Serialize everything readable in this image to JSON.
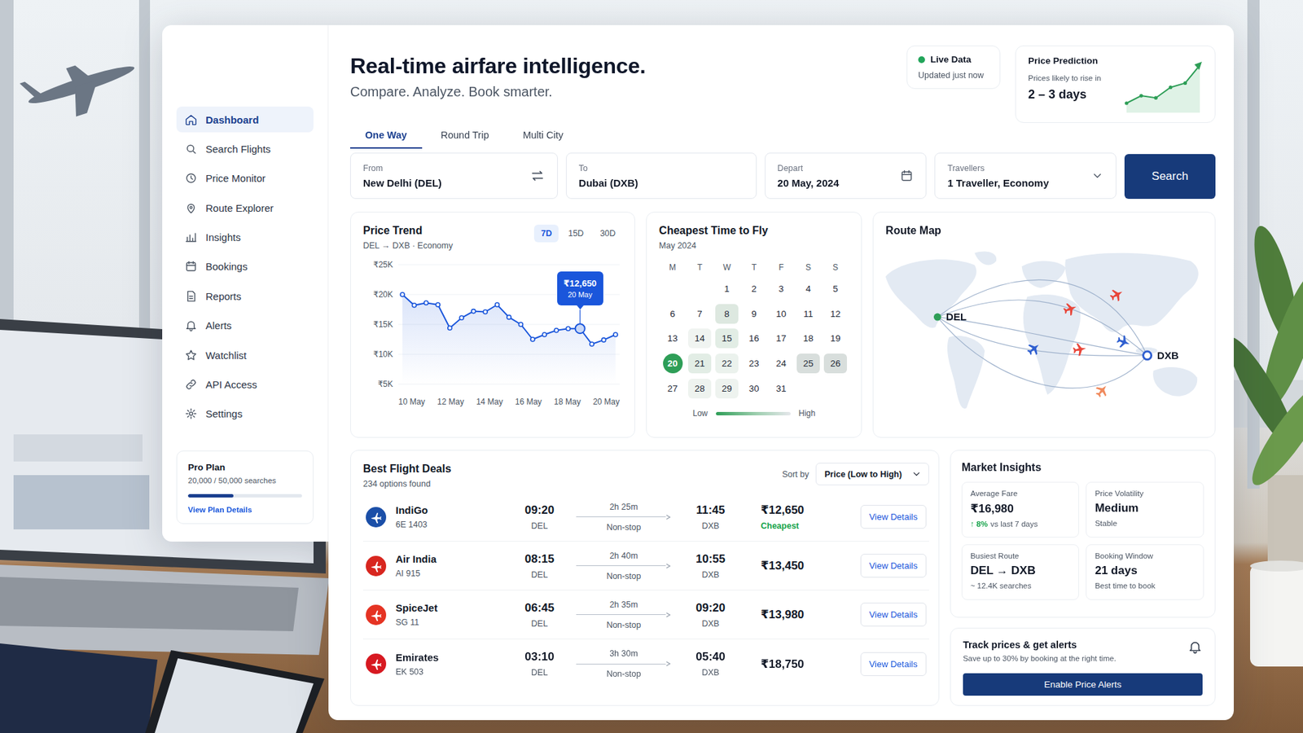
{
  "sidebar": {
    "items": [
      {
        "label": "Dashboard",
        "selected": true
      },
      {
        "label": "Search Flights",
        "selected": false
      },
      {
        "label": "Price Monitor",
        "selected": false
      },
      {
        "label": "Route Explorer",
        "selected": false
      },
      {
        "label": "Insights",
        "selected": false
      },
      {
        "label": "Bookings",
        "selected": false
      },
      {
        "label": "Reports",
        "selected": false
      },
      {
        "label": "Alerts",
        "selected": false
      },
      {
        "label": "Watchlist",
        "selected": false
      },
      {
        "label": "API Access",
        "selected": false
      },
      {
        "label": "Settings",
        "selected": false
      }
    ],
    "plan": {
      "title": "Pro Plan",
      "usage": "20,000 / 50,000 searches",
      "level": 0.4,
      "link": "View Plan Details"
    }
  },
  "header": {
    "title": "Real-time airfare intelligence.",
    "subtitle": "Compare. Analyze. Book smarter."
  },
  "live_status": {
    "label": "Live Data",
    "updated": "Updated just now",
    "live": true
  },
  "price_prediction": {
    "title": "Price Prediction",
    "caption": "Prices likely to rise in",
    "value": "2 – 3 days",
    "values": [
      1.0,
      1.7,
      1.5,
      2.5,
      2.9,
      4.6
    ]
  },
  "trip_tabs": [
    {
      "label": "One Way",
      "selected": true
    },
    {
      "label": "Round Trip",
      "selected": false
    },
    {
      "label": "Multi City",
      "selected": false
    }
  ],
  "search": {
    "fields": [
      {
        "label": "From",
        "value": "New Delhi (DEL)",
        "kind": "origin"
      },
      {
        "label": "To",
        "value": "Dubai (DXB)",
        "kind": "destination"
      },
      {
        "label": "Depart",
        "value": "20 May, 2024",
        "kind": "date"
      },
      {
        "label": "Travellers",
        "value": "1 Traveller, Economy",
        "kind": "select"
      }
    ],
    "button": "Search"
  },
  "price_trend": {
    "title": "Price Trend",
    "subtitle": "DEL → DXB · Economy",
    "ranges": [
      {
        "label": "7D",
        "selected": true
      },
      {
        "label": "15D",
        "selected": false
      },
      {
        "label": "30D",
        "selected": false
      }
    ],
    "y_ticks": [
      "₹25K",
      "₹20K",
      "₹15K",
      "₹10K",
      "₹5K"
    ],
    "x_ticks": [
      "10 May",
      "12 May",
      "14 May",
      "16 May",
      "18 May",
      "20 May"
    ],
    "values": [
      20000,
      18200,
      18600,
      18300,
      14400,
      16100,
      17200,
      17100,
      18300,
      16200,
      15000,
      12500,
      13300,
      14000,
      14300,
      14300,
      11700,
      12400,
      13300
    ],
    "tooltip": {
      "value": "₹12,650",
      "date": "20 May",
      "point_index": 15
    }
  },
  "calendar": {
    "title": "Cheapest Time to Fly",
    "month": "May 2024",
    "weekdays": [
      "M",
      "T",
      "W",
      "T",
      "F",
      "S",
      "S"
    ],
    "leading_blank_days": 2,
    "days": [
      {
        "day": "1",
        "color": "#ffffff",
        "selected": false
      },
      {
        "day": "2",
        "color": "#ffffff",
        "selected": false
      },
      {
        "day": "3",
        "color": "#ffffff",
        "selected": false
      },
      {
        "day": "4",
        "color": "#ffffff",
        "selected": false
      },
      {
        "day": "5",
        "color": "#ffffff",
        "selected": false
      },
      {
        "day": "6",
        "color": "#ffffff",
        "selected": false
      },
      {
        "day": "7",
        "color": "#ffffff",
        "selected": false
      },
      {
        "day": "8",
        "color": "#dde8e0",
        "selected": false
      },
      {
        "day": "9",
        "color": "#ffffff",
        "selected": false
      },
      {
        "day": "10",
        "color": "#ffffff",
        "selected": false
      },
      {
        "day": "11",
        "color": "#ffffff",
        "selected": false
      },
      {
        "day": "12",
        "color": "#ffffff",
        "selected": false
      },
      {
        "day": "13",
        "color": "#ffffff",
        "selected": false
      },
      {
        "day": "14",
        "color": "#f0f4f1",
        "selected": false
      },
      {
        "day": "15",
        "color": "#e2ede5",
        "selected": false
      },
      {
        "day": "16",
        "color": "#ffffff",
        "selected": false
      },
      {
        "day": "17",
        "color": "#ffffff",
        "selected": false
      },
      {
        "day": "18",
        "color": "#ffffff",
        "selected": false
      },
      {
        "day": "19",
        "color": "#ffffff",
        "selected": false
      },
      {
        "day": "20",
        "color": "#2e9e57",
        "selected": true
      },
      {
        "day": "21",
        "color": "#e2ede5",
        "selected": false
      },
      {
        "day": "22",
        "color": "#ebf2ed",
        "selected": false
      },
      {
        "day": "23",
        "color": "#ffffff",
        "selected": false
      },
      {
        "day": "24",
        "color": "#ffffff",
        "selected": false
      },
      {
        "day": "25",
        "color": "#d8dedc",
        "selected": false
      },
      {
        "day": "26",
        "color": "#d8dedc",
        "selected": false
      },
      {
        "day": "27",
        "color": "#ffffff",
        "selected": false
      },
      {
        "day": "28",
        "color": "#eef3ef",
        "selected": false
      },
      {
        "day": "29",
        "color": "#eef3ef",
        "selected": false
      },
      {
        "day": "30",
        "color": "#ffffff",
        "selected": false
      },
      {
        "day": "31",
        "color": "#ffffff",
        "selected": false
      }
    ],
    "legend": {
      "low": "Low",
      "high": "High"
    }
  },
  "route_map": {
    "title": "Route Map",
    "origin": "DEL",
    "destination": "DXB",
    "planes": [
      {
        "color": "#e8463a"
      },
      {
        "color": "#e8463a"
      },
      {
        "color": "#2f5fd0"
      },
      {
        "color": "#e8463a"
      },
      {
        "color": "#2f5fd0"
      },
      {
        "color": "#f08a5d"
      }
    ]
  },
  "deals": {
    "title": "Best Flight Deals",
    "count": "234 options found",
    "sort_label": "Sort by",
    "sort_value": "Price (Low to High)",
    "rows": [
      {
        "airline": "IndiGo",
        "flight": "6E 1403",
        "dep_time": "09:20",
        "dep_airport": "DEL",
        "duration": "2h 25m",
        "stops": "Non-stop",
        "arr_time": "11:45",
        "arr_airport": "DXB",
        "price": "₹12,650",
        "badge": "Cheapest",
        "button": "View Details",
        "color": "#1b4fa8"
      },
      {
        "airline": "Air India",
        "flight": "AI 915",
        "dep_time": "08:15",
        "dep_airport": "DEL",
        "duration": "2h 40m",
        "stops": "Non-stop",
        "arr_time": "10:55",
        "arr_airport": "DXB",
        "price": "₹13,450",
        "button": "View Details",
        "color": "#d8261f"
      },
      {
        "airline": "SpiceJet",
        "flight": "SG 11",
        "dep_time": "06:45",
        "dep_airport": "DEL",
        "duration": "2h 35m",
        "stops": "Non-stop",
        "arr_time": "09:20",
        "arr_airport": "DXB",
        "price": "₹13,980",
        "button": "View Details",
        "color": "#e53323"
      },
      {
        "airline": "Emirates",
        "flight": "EK 503",
        "dep_time": "03:10",
        "dep_airport": "DEL",
        "duration": "3h 30m",
        "stops": "Non-stop",
        "arr_time": "05:40",
        "arr_airport": "DXB",
        "price": "₹18,750",
        "button": "View Details",
        "color": "#d71921"
      }
    ]
  },
  "market_insights": {
    "title": "Market Insights",
    "tiles": [
      {
        "label": "Average Fare",
        "value": "₹16,980",
        "change": "↑ 8%",
        "note": "vs last 7 days",
        "kind": "trend"
      },
      {
        "label": "Price Volatility",
        "value": "Medium",
        "note": "Stable",
        "kind": "plain"
      },
      {
        "label": "Busiest Route",
        "value": "DEL → DXB",
        "note": "~ 12.4K searches",
        "kind": "plain"
      },
      {
        "label": "Booking Window",
        "value": "21 days",
        "note": "Best time to book",
        "kind": "plain"
      }
    ]
  },
  "price_alerts": {
    "title": "Track prices & get alerts",
    "subtitle": "Save up to 30% by booking at the right time.",
    "button": "Enable Price Alerts"
  }
}
